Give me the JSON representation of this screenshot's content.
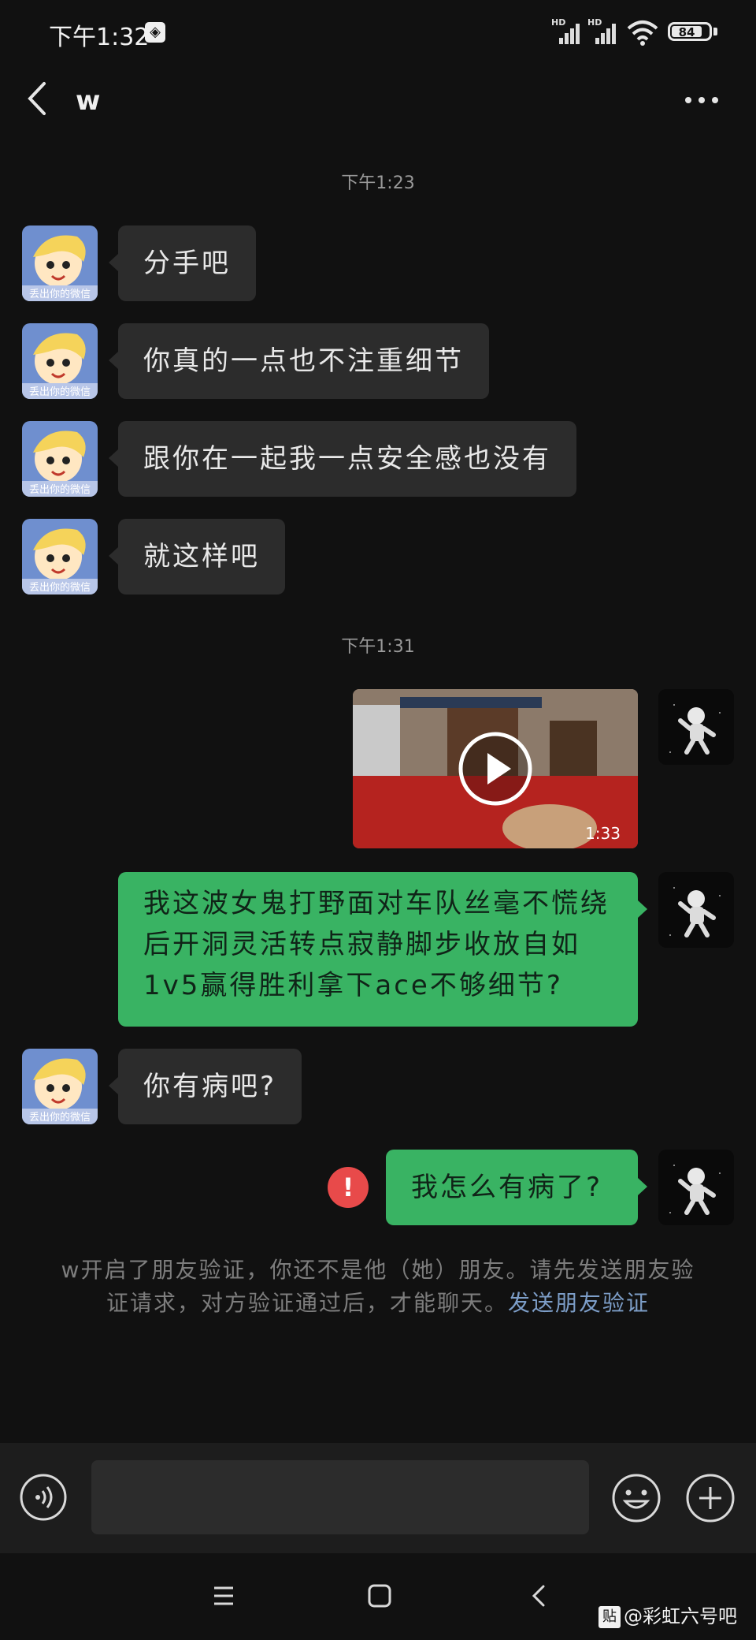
{
  "status_bar": {
    "time": "下午1:32",
    "network_1": "HD",
    "network_2": "HD",
    "battery": "84"
  },
  "header": {
    "title": "w"
  },
  "timestamps": [
    "下午1:23",
    "下午1:31"
  ],
  "avatar_caption": "丢出你的微信",
  "messages": [
    {
      "side": "in",
      "text": "分手吧"
    },
    {
      "side": "in",
      "text": "你真的一点也不注重细节"
    },
    {
      "side": "in",
      "text": "跟你在一起我一点安全感也没有"
    },
    {
      "side": "in",
      "text": "就这样吧"
    },
    {
      "side": "out",
      "type": "video",
      "duration": "1:33"
    },
    {
      "side": "out",
      "text": "我这波女鬼打野面对车队丝毫不慌绕后开洞灵活转点寂静脚步收放自如1v5赢得胜利拿下ace不够细节?"
    },
    {
      "side": "in",
      "text": "你有病吧?"
    },
    {
      "side": "out",
      "text": "我怎么有病了?",
      "failed": true
    }
  ],
  "error_mark": "!",
  "notice": {
    "text": "w开启了朋友验证，你还不是他（她）朋友。请先发送朋友验证请求，对方验证通过后，才能聊天。",
    "link": "发送朋友验证"
  },
  "input": {
    "placeholder": ""
  },
  "watermark": {
    "badge": "贴",
    "text": "@彩虹六号吧"
  },
  "colors": {
    "background": "#111111",
    "incoming_bubble": "#2c2c2c",
    "outgoing_bubble": "#39b363",
    "error": "#e84a4a",
    "link": "#7d9ec8"
  }
}
